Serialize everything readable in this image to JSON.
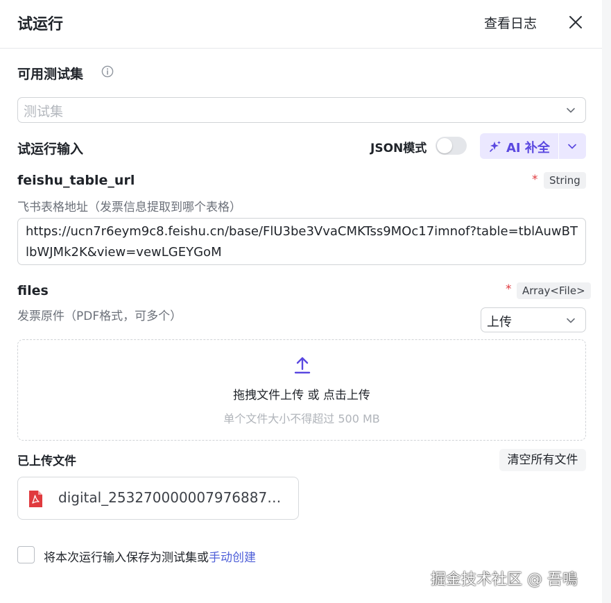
{
  "header": {
    "title": "试运行",
    "logs_label": "查看日志"
  },
  "testset": {
    "label": "可用测试集",
    "placeholder": "测试集"
  },
  "input_section": {
    "label": "试运行输入",
    "json_mode_label": "JSON模式",
    "json_mode_on": false,
    "ai_button_label": "AI 补全"
  },
  "fields": [
    {
      "name": "feishu_table_url",
      "required_mark": "*",
      "type": "String",
      "description": "飞书表格地址（发票信息提取到哪个表格）",
      "value": "https://ucn7r6eym9c8.feishu.cn/base/FlU3be3VvaCMKTss9MOc17imnof?table=tblAuwBTlbWJMk2K&view=vewLGEYGoM"
    },
    {
      "name": "files",
      "required_mark": "*",
      "type": "Array<File>",
      "description": "发票原件（PDF格式，可多个）",
      "mode": "上传"
    }
  ],
  "dropzone": {
    "main_prefix": "拖拽文件上传",
    "main_sep": " 或 ",
    "main_suffix": "点击上传",
    "hint": "单个文件大小不得超过 500 MB"
  },
  "uploaded": {
    "label": "已上传文件",
    "clear_label": "清空所有文件",
    "files": [
      "digital_253270000007976887…"
    ]
  },
  "save": {
    "text": "将本次运行输入保存为测试集或",
    "link": "手动创建"
  },
  "watermark": "掘金技术社区 @ 吾鳴",
  "colors": {
    "accent": "#5a48e0",
    "link": "#4e5fd8",
    "required": "#e0393e",
    "pdf": "#e03a3e"
  }
}
